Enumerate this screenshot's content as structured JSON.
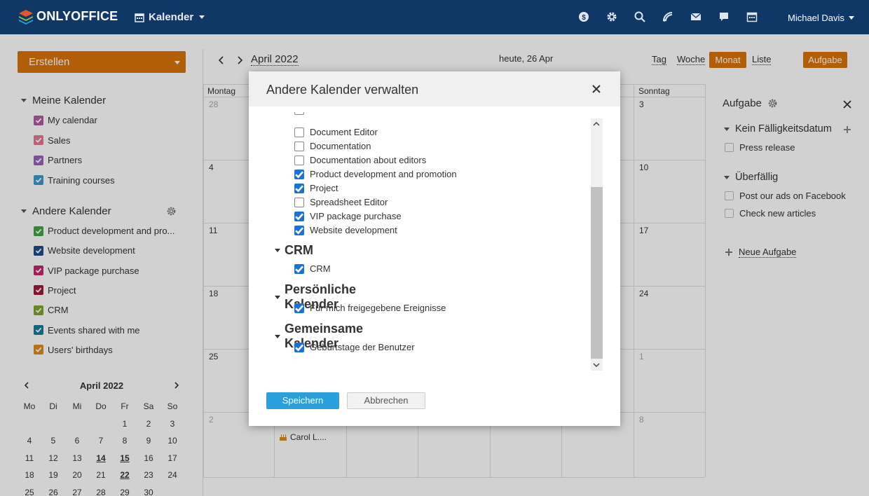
{
  "header": {
    "logo": "ONLYOFFICE",
    "module": "Kalender",
    "user": "Michael Davis"
  },
  "sidebar": {
    "create_label": "Erstellen",
    "my_calendars_title": "Meine Kalender",
    "my_calendars": [
      {
        "label": "My calendar",
        "color": "#b05aa2",
        "checked": true
      },
      {
        "label": "Sales",
        "color": "#e07b96",
        "checked": true
      },
      {
        "label": "Partners",
        "color": "#9a63b9",
        "checked": true
      },
      {
        "label": "Training courses",
        "color": "#3b9ad0",
        "checked": true
      }
    ],
    "other_calendars_title": "Andere Kalender",
    "other_calendars": [
      {
        "label": "Product development and pro...",
        "color": "#3fa53f",
        "checked": true
      },
      {
        "label": "Website development",
        "color": "#1f4e8c",
        "checked": true
      },
      {
        "label": "VIP package purchase",
        "color": "#c2266c",
        "checked": true
      },
      {
        "label": "Project",
        "color": "#a11a3a",
        "checked": true
      },
      {
        "label": "CRM",
        "color": "#7fa52b",
        "checked": true
      },
      {
        "label": "Events shared with me",
        "color": "#167aa0",
        "checked": true
      },
      {
        "label": "Users' birthdays",
        "color": "#e08a1a",
        "checked": true
      }
    ]
  },
  "mini_calendar": {
    "title": "April 2022",
    "weekdays": [
      "Mo",
      "Di",
      "Mi",
      "Do",
      "Fr",
      "Sa",
      "So"
    ],
    "rows": [
      [
        "",
        "",
        "",
        "",
        "1",
        "2",
        "3"
      ],
      [
        "4",
        "5",
        "6",
        "7",
        "8",
        "9",
        "10"
      ],
      [
        "11",
        "12",
        "13",
        "14",
        "15",
        "16",
        "17"
      ],
      [
        "18",
        "19",
        "20",
        "21",
        "22",
        "23",
        "24"
      ],
      [
        "25",
        "26",
        "27",
        "28",
        "29",
        "30",
        ""
      ]
    ],
    "bold_days": [
      "14",
      "15",
      "22"
    ]
  },
  "main": {
    "month_title": "April 2022",
    "today_label": "heute, 26 Apr",
    "views": [
      "Tag",
      "Woche",
      "Monat",
      "Liste"
    ],
    "active_view": "Monat",
    "task_button": "Aufgabe",
    "col_monday": "Montag",
    "col_sunday": "Sonntag",
    "monday_dates": [
      "28",
      "4",
      "11",
      "18",
      "25",
      "2"
    ],
    "sunday_dates": [
      "3",
      "10",
      "17",
      "24",
      "1",
      "8"
    ],
    "event_label": "Carol L...."
  },
  "right_panel": {
    "title": "Aufgabe",
    "no_due_title": "Kein Fälligkeitsdatum",
    "no_due_tasks": [
      "Press release"
    ],
    "overdue_title": "Überfällig",
    "overdue_tasks": [
      "Post our ads on Facebook",
      "Check new articles"
    ],
    "new_task": "Neue Aufgabe"
  },
  "dialog": {
    "title": "Andere Kalender verwalten",
    "list_items": [
      {
        "label": "Document Editor",
        "checked": false
      },
      {
        "label": "Documentation",
        "checked": false
      },
      {
        "label": "Documentation about editors",
        "checked": false
      },
      {
        "label": "Product development and promotion",
        "checked": true
      },
      {
        "label": "Project",
        "checked": true
      },
      {
        "label": "Spreadsheet Editor",
        "checked": false
      },
      {
        "label": "VIP package purchase",
        "checked": true
      },
      {
        "label": "Website development",
        "checked": true
      }
    ],
    "groups": [
      {
        "title": "CRM",
        "items": [
          {
            "label": "CRM",
            "checked": true
          }
        ]
      },
      {
        "title": "Persönliche Kalender",
        "items": [
          {
            "label": "Für mich freigegebene Ereignisse",
            "checked": true
          }
        ]
      },
      {
        "title": "Gemeinsame Kalender",
        "items": [
          {
            "label": "Geburtstage der Benutzer",
            "checked": true
          }
        ]
      }
    ],
    "save_label": "Speichern",
    "cancel_label": "Abbrechen"
  }
}
